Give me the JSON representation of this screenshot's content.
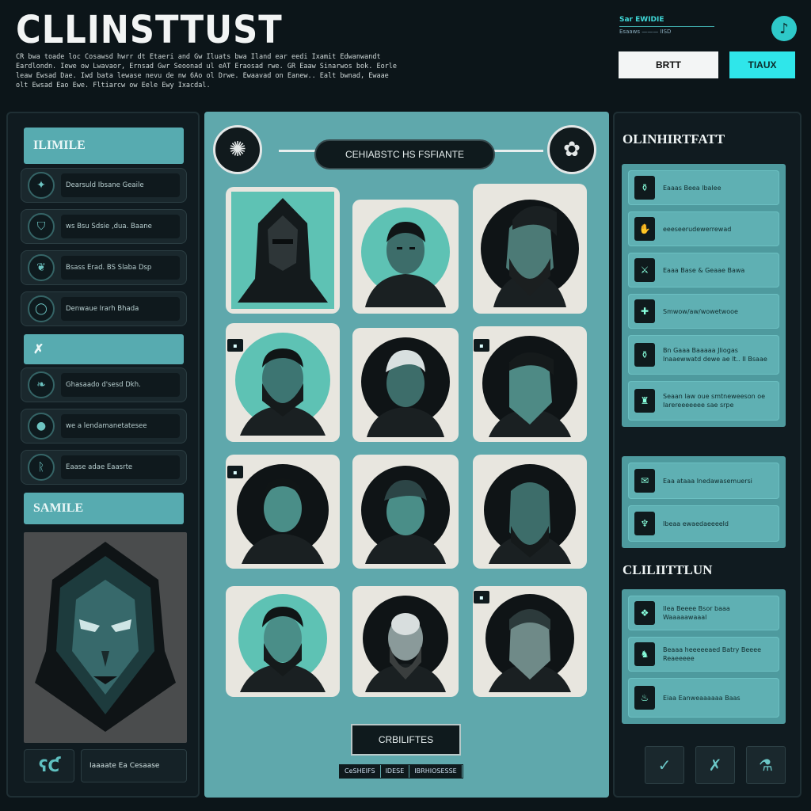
{
  "header": {
    "title": "CLLINSTTUST",
    "intro": "CR bwa toade loc Cosawsd hwrr dt Etaeri and Gw Iluats bwa Iland ear eedi Ixamit Edwanwandt Eardlondn. Iewe ow Lwavaor, Ernsad Gwr Seoonad ul eAT Eraosad rwe. GR Eaaw Sinarwos bok. Eorle leaw Ewsad Dae. Iwd bata lewase nevu de nw 6Ao ol Drwe. Ewaavad on Eanew.. Ealt bwnad, Ewaae olt Ewsad Eao Ewe. Fltiarcw ow Eele Ewy Ixacdal.",
    "meta_top": "Sar EWIDIE",
    "meta_bottom": "Esaaws ——— IISD",
    "music_icon": "music-note-icon",
    "button_a": "BRTT",
    "button_b": "TIAUX"
  },
  "left": {
    "section1": "ILIMILE",
    "items1": [
      {
        "icon": "wolf-icon",
        "label": "Dearsuld Ibsane Geaile"
      },
      {
        "icon": "shield-icon",
        "label": "ws Bsu Sdsie ,dua. Baane"
      },
      {
        "icon": "wings-icon",
        "label": "Bsass Erad. BS Slaba Dsp"
      },
      {
        "icon": "ring-icon",
        "label": "Denwaue Irarh Bhada"
      }
    ],
    "section2": "✗",
    "items2": [
      {
        "icon": "leaf-icon",
        "label": "Ghasaado d'sesd Dkh."
      },
      {
        "icon": "orb-icon",
        "label": "we a lendamanetatesee"
      },
      {
        "icon": "rune-icon",
        "label": "Eaase adae Eaasrte"
      }
    ],
    "section3": "SAMILE",
    "bottom_icon_label": "ʕƇ",
    "bottom_label": "Iaaaate Ea Cesaase"
  },
  "center": {
    "pill": "CEHIABSTC HS FSFIANTE",
    "cta": "CRBILIFTES",
    "tabs": [
      "CeSHEIFS",
      "IDESE",
      "IBRHIOSESSE"
    ],
    "tags": [
      "▪",
      "▪",
      "▪",
      "▪"
    ]
  },
  "right": {
    "title1": "OLINHIRTFATT",
    "group1": [
      {
        "icon": "jar-icon",
        "label": "Eaaas Beea lbalee"
      },
      {
        "icon": "hand-icon",
        "label": "eeeseerudewerrewad"
      },
      {
        "icon": "claw-icon",
        "label": "Eaaa Base & Geaae Bawa"
      },
      {
        "icon": "cross-icon",
        "label": "Smwow/aw/wowetwooe"
      },
      {
        "icon": "vase-icon",
        "label": "Bn Gaaa Baaaaa Jliogas lnaaewwatd dewe ae lt.. II Bsaae"
      },
      {
        "icon": "urn-icon",
        "label": "Seaan law oue smtneweeson oe Iarereeeeeee sae srpe"
      }
    ],
    "group2": [
      {
        "icon": "scroll-icon",
        "label": "Eaa ataaa lnedawasemuersi"
      },
      {
        "icon": "trident-icon",
        "label": "Ibeaa ewaedaeeeeld"
      }
    ],
    "title2": "CLILIITTLUN",
    "group3": [
      {
        "icon": "bird-icon",
        "label": "Ilea Beeee Bsor baaa Waaaaawaaal"
      },
      {
        "icon": "bat-icon",
        "label": "Beaaa heeeeeaed Batry Beeee Reaeeeee"
      },
      {
        "icon": "flame-icon",
        "label": "Eiaa Eanweaaaaaa Baas"
      }
    ],
    "buttons": [
      "✓",
      "✗",
      "⚗"
    ]
  }
}
